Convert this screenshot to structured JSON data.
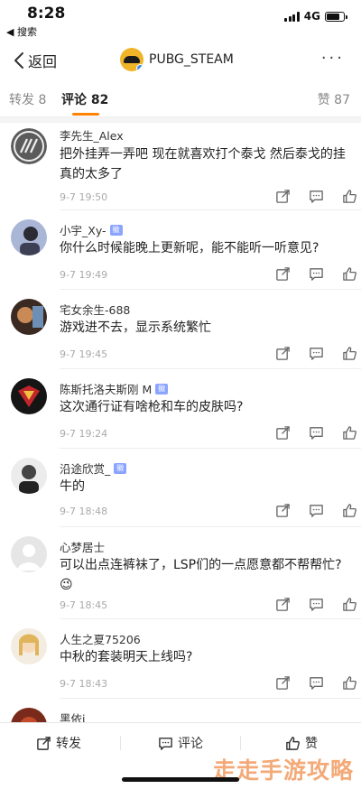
{
  "status_bar": {
    "time": "8:28",
    "back_app": "◀ 搜索",
    "network": "4G",
    "battery_pct": 0.8
  },
  "nav": {
    "back_label": "返回",
    "title": "PUBG_STEAM",
    "more": "···"
  },
  "tabs": {
    "repost": "转发 8",
    "comment": "评论 82",
    "like": "赞 87"
  },
  "comments": [
    {
      "name": "李先生_Alex",
      "tag": "",
      "text": "把外挂弄一弄吧 现在就喜欢打个泰戈 然后泰戈的挂真的太多了",
      "time": "9-7 19:50",
      "avatar_color": "#555555"
    },
    {
      "name": "小宇_Xy-",
      "tag": "徽",
      "text": "你什么时候能晚上更新呢，能不能听一听意见?",
      "time": "9-7 19:49",
      "avatar_color": "#6f7fa8"
    },
    {
      "name": "宅女余生-688",
      "tag": "",
      "text": "游戏进不去，显示系统繁忙",
      "time": "9-7 19:45",
      "avatar_color": "#5a3d2b"
    },
    {
      "name": "陈斯托洛夫斯刚 M",
      "tag": "徽",
      "text": "这次通行证有啥枪和车的皮肤吗?",
      "time": "9-7 19:24",
      "avatar_color": "#1c1c1c"
    },
    {
      "name": "沿途欣赏_",
      "tag": "徽",
      "text": "牛的",
      "time": "9-7 18:48",
      "avatar_color": "#cfcfcf"
    },
    {
      "name": "心梦居士",
      "tag": "",
      "text": "可以出点连裤袜了，LSP们的一点愿意都不帮帮忙? 😉",
      "time": "9-7 18:45",
      "avatar_color": "#e4e4e4"
    },
    {
      "name": "人生之夏75206",
      "tag": "",
      "text": "中秋的套装明天上线吗?",
      "time": "9-7 18:43",
      "avatar_color": "#e9dcc0"
    },
    {
      "name": "黑依i",
      "tag": "",
      "text": "",
      "time": "",
      "avatar_color": "#7a2a1a"
    }
  ],
  "bottom_bar": {
    "repost": "转发",
    "comment": "评论",
    "like": "赞"
  },
  "watermark": "走走手游攻略",
  "colors": {
    "accent": "#ff8200",
    "tag": "#8aa4ff"
  }
}
